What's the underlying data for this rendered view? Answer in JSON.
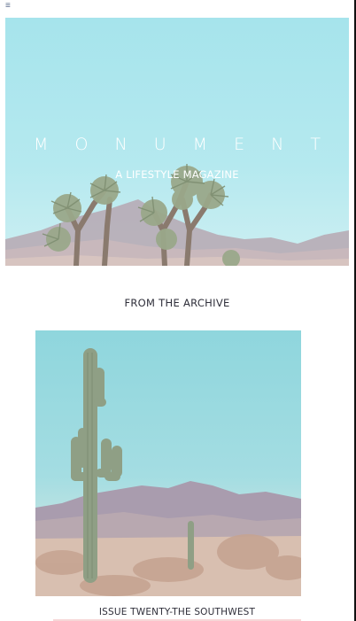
{
  "header": {
    "menu_icon": "hamburger-menu-icon",
    "menu_glyph": "≡"
  },
  "hero": {
    "title": "M O N U M E N T",
    "subtitle": "A LIFESTYLE MAGAZINE"
  },
  "archive": {
    "heading": "FROM THE ARCHIVE",
    "items": [
      {
        "caption": "ISSUE TWENTY-THE SOUTHWEST"
      }
    ]
  },
  "colors": {
    "sky": "#a6e4ec",
    "title_text": "#ffffff",
    "body_text": "#2f2f3a"
  }
}
